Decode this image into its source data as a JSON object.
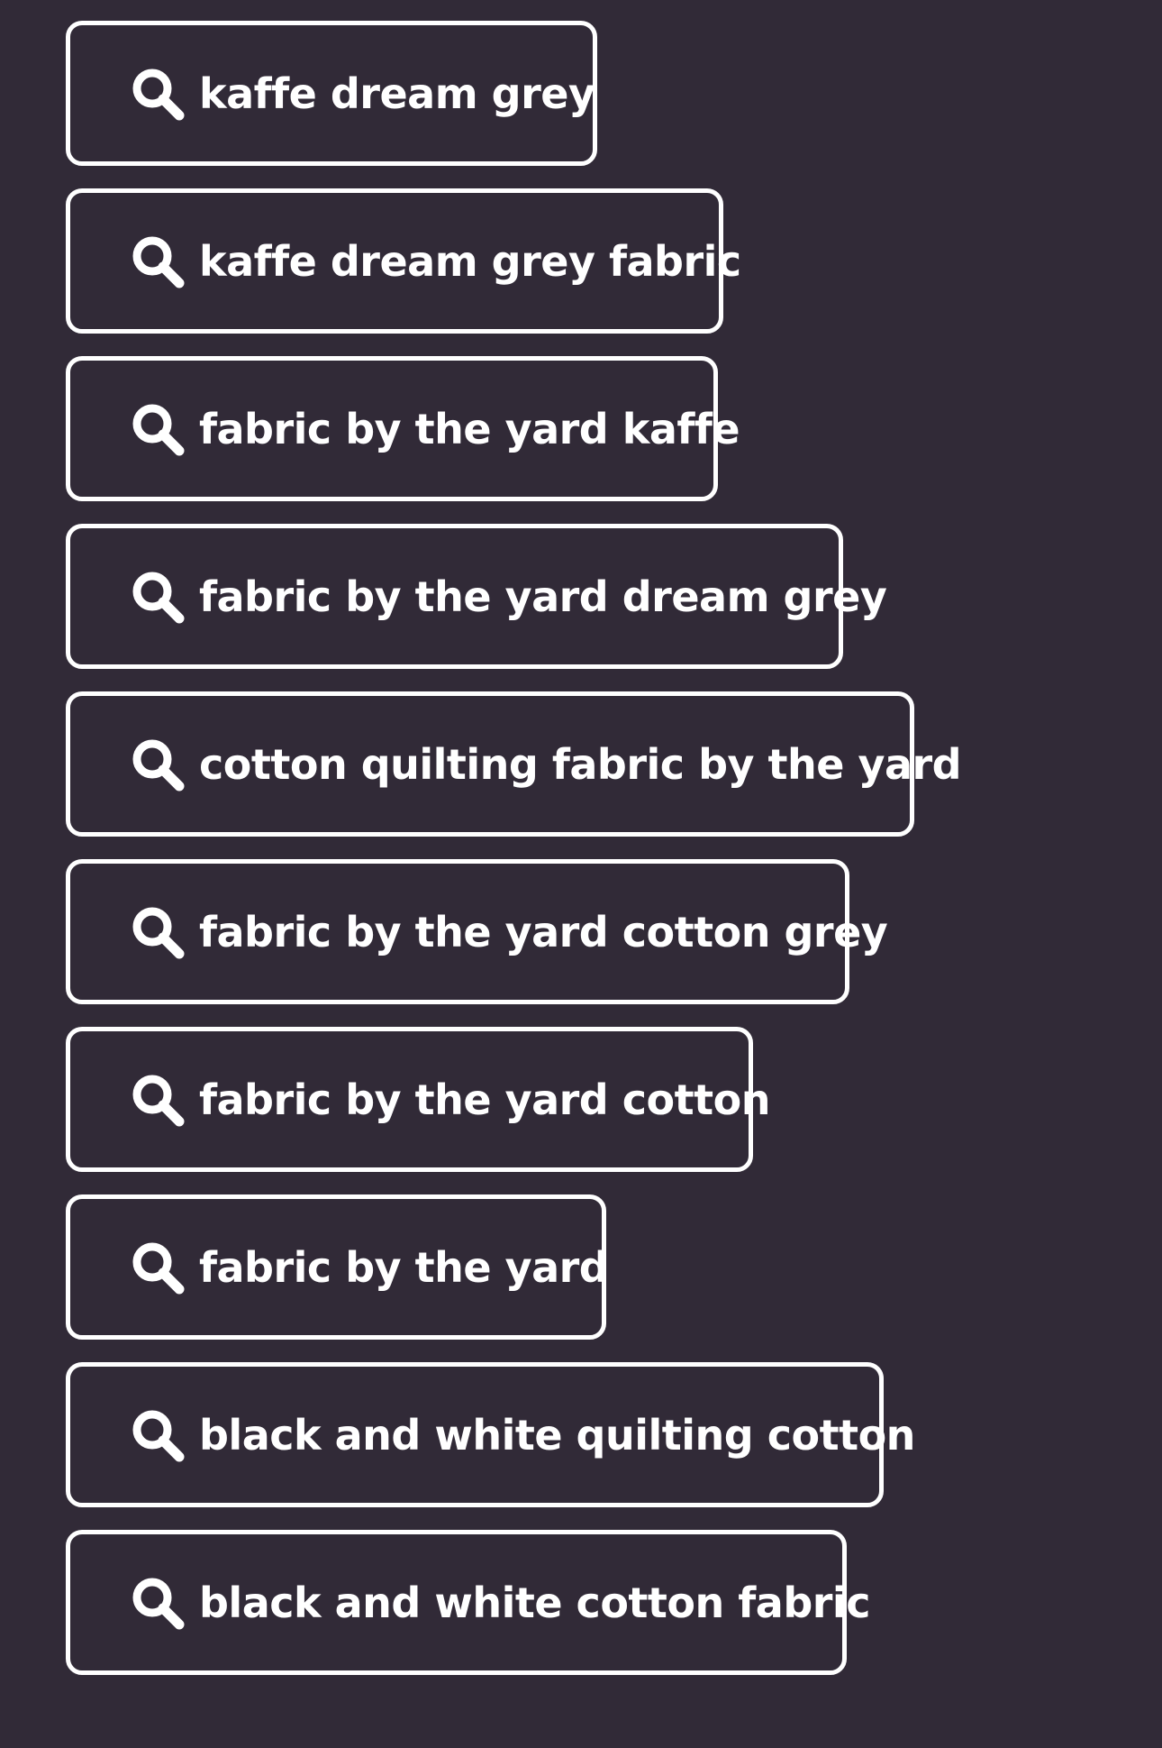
{
  "colors": {
    "background": "#312a37",
    "foreground": "#ffffff"
  },
  "suggestions": [
    {
      "label": "kaffe dream grey",
      "icon": "search-icon"
    },
    {
      "label": "kaffe dream grey fabric",
      "icon": "search-icon"
    },
    {
      "label": "fabric by the yard kaffe",
      "icon": "search-icon"
    },
    {
      "label": "fabric by the yard dream grey",
      "icon": "search-icon"
    },
    {
      "label": "cotton quilting fabric by the yard",
      "icon": "search-icon"
    },
    {
      "label": "fabric by the yard cotton grey",
      "icon": "search-icon"
    },
    {
      "label": "fabric by the yard cotton",
      "icon": "search-icon"
    },
    {
      "label": "fabric by the yard",
      "icon": "search-icon"
    },
    {
      "label": "black and white quilting cotton",
      "icon": "search-icon"
    },
    {
      "label": "black and white cotton fabric",
      "icon": "search-icon"
    }
  ]
}
